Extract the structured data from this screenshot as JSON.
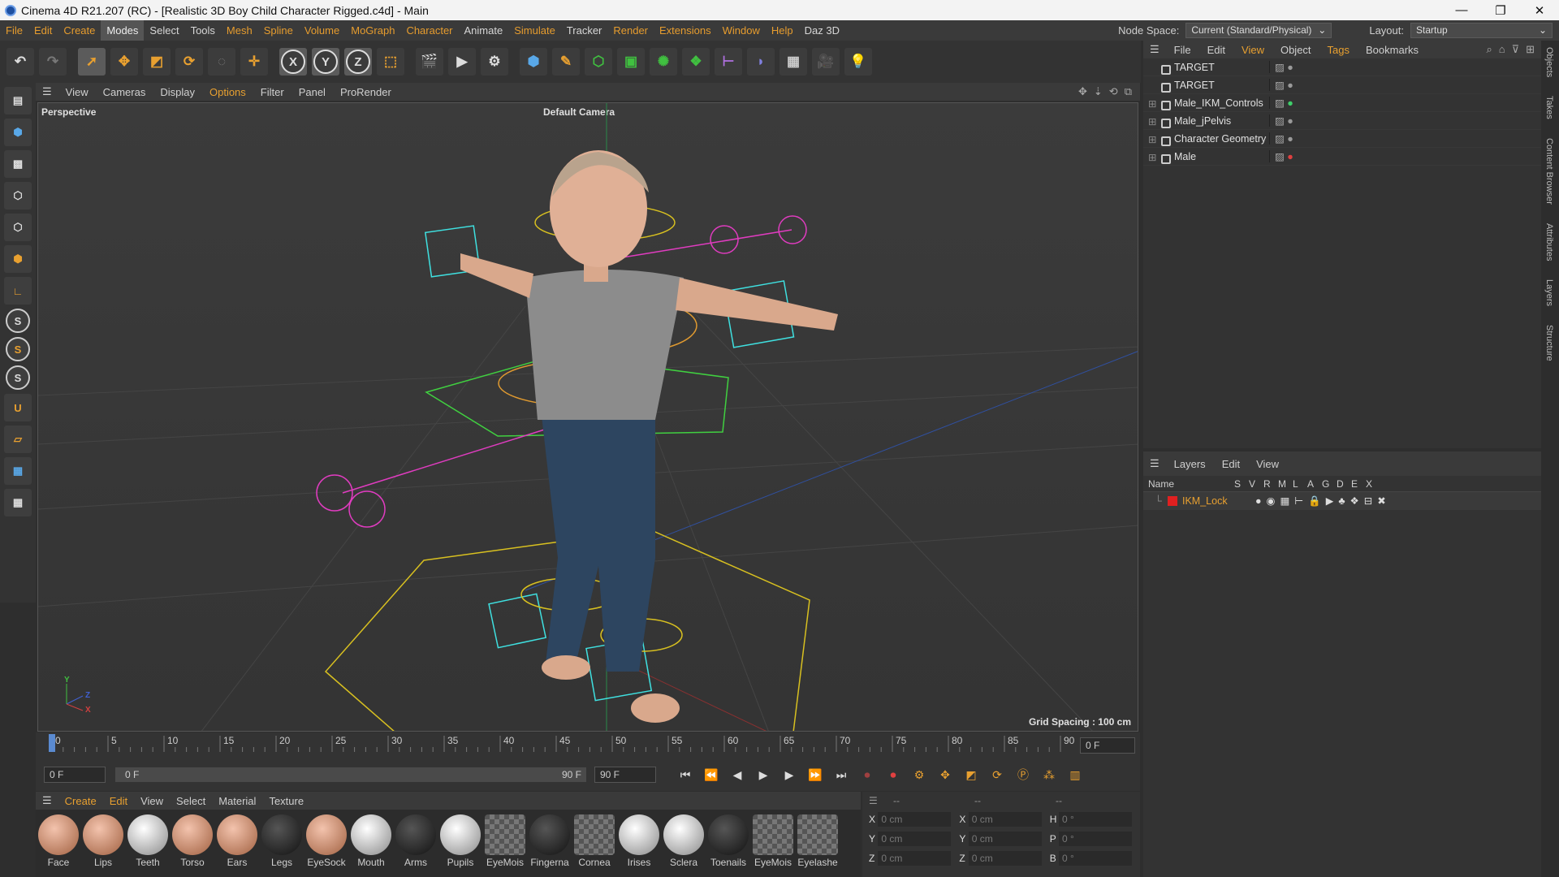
{
  "window": {
    "title": "Cinema 4D R21.207 (RC) - [Realistic 3D Boy Child Character Rigged.c4d] - Main",
    "controls": [
      "—",
      "❐",
      "✕"
    ]
  },
  "menu": {
    "items": [
      {
        "label": "File",
        "color": "orange"
      },
      {
        "label": "Edit",
        "color": "orange"
      },
      {
        "label": "Create",
        "color": "orange"
      },
      {
        "label": "Modes",
        "color": "active"
      },
      {
        "label": "Select",
        "color": "white"
      },
      {
        "label": "Tools",
        "color": "white"
      },
      {
        "label": "Mesh",
        "color": "orange"
      },
      {
        "label": "Spline",
        "color": "orange"
      },
      {
        "label": "Volume",
        "color": "orange"
      },
      {
        "label": "MoGraph",
        "color": "orange"
      },
      {
        "label": "Character",
        "color": "orange"
      },
      {
        "label": "Animate",
        "color": "white"
      },
      {
        "label": "Simulate",
        "color": "orange"
      },
      {
        "label": "Tracker",
        "color": "white"
      },
      {
        "label": "Render",
        "color": "orange"
      },
      {
        "label": "Extensions",
        "color": "orange"
      },
      {
        "label": "Window",
        "color": "orange"
      },
      {
        "label": "Help",
        "color": "orange"
      },
      {
        "label": "Daz 3D",
        "color": "white"
      }
    ],
    "node_space_label": "Node Space:",
    "node_space_value": "Current (Standard/Physical)",
    "layout_label": "Layout:",
    "layout_value": "Startup"
  },
  "toolbar": {
    "icons": [
      "undo-icon",
      "redo-icon",
      "select-arrow-icon",
      "move-icon",
      "scale-icon",
      "rotate-icon",
      "recent-tool-icon",
      "world-axis-icon",
      "x-axis-icon",
      "y-axis-icon",
      "z-axis-icon",
      "coordinate-system-icon",
      "render-view-icon",
      "render-picture-icon",
      "render-settings-icon",
      "cube-icon",
      "pen-icon",
      "subdivision-icon",
      "extrude-icon",
      "mograph-cloner-icon",
      "array-icon",
      "symmetry-icon",
      "deformer-icon",
      "floor-icon",
      "camera-icon",
      "light-icon"
    ],
    "axis_labels": [
      "X",
      "Y",
      "Z"
    ]
  },
  "viewport": {
    "menu": [
      {
        "label": "View",
        "color": "white"
      },
      {
        "label": "Cameras",
        "color": "white"
      },
      {
        "label": "Display",
        "color": "white"
      },
      {
        "label": "Options",
        "color": "orange"
      },
      {
        "label": "Filter",
        "color": "white"
      },
      {
        "label": "Panel",
        "color": "white"
      },
      {
        "label": "ProRender",
        "color": "white"
      }
    ],
    "view_name": "Perspective",
    "camera": "Default Camera",
    "grid_spacing": "Grid Spacing : 100 cm",
    "axis_labels": [
      "Y",
      "Z",
      "X"
    ]
  },
  "timeline": {
    "ticks": [
      "0",
      "5",
      "10",
      "15",
      "20",
      "25",
      "30",
      "35",
      "40",
      "45",
      "50",
      "55",
      "60",
      "65",
      "70",
      "75",
      "80",
      "85",
      "90"
    ],
    "current_frame": "0 F",
    "start_field": "0 F",
    "range_start": "0 F",
    "range_end": "90 F",
    "end_field": "90 F",
    "min_frame": 0,
    "max_frame": 90,
    "playhead_frame": 0
  },
  "materials": {
    "menu": [
      {
        "label": "Create",
        "color": "orange"
      },
      {
        "label": "Edit",
        "color": "orange"
      },
      {
        "label": "View",
        "color": "white"
      },
      {
        "label": "Select",
        "color": "white"
      },
      {
        "label": "Material",
        "color": "white"
      },
      {
        "label": "Texture",
        "color": "white"
      }
    ],
    "items": [
      {
        "name": "Face",
        "style": "skin"
      },
      {
        "name": "Lips",
        "style": "skin"
      },
      {
        "name": "Teeth",
        "style": "white"
      },
      {
        "name": "Torso",
        "style": "skin"
      },
      {
        "name": "Ears",
        "style": "skin"
      },
      {
        "name": "Legs",
        "style": "dark"
      },
      {
        "name": "EyeSock",
        "style": "skin"
      },
      {
        "name": "Mouth",
        "style": "white"
      },
      {
        "name": "Arms",
        "style": "dark"
      },
      {
        "name": "Pupils",
        "style": "white"
      },
      {
        "name": "EyeMois",
        "style": "check"
      },
      {
        "name": "Fingerna",
        "style": "dark"
      },
      {
        "name": "Cornea",
        "style": "check"
      },
      {
        "name": "Irises",
        "style": "white"
      },
      {
        "name": "Sclera",
        "style": "white"
      },
      {
        "name": "Toenails",
        "style": "dark"
      },
      {
        "name": "EyeMois",
        "style": "check"
      },
      {
        "name": "Eyelashe",
        "style": "check"
      }
    ]
  },
  "coords": {
    "header": [
      "--",
      "--",
      "--"
    ],
    "rows": [
      {
        "a": "X",
        "av": "0 cm",
        "b": "X",
        "bv": "0 cm",
        "c": "H",
        "cv": "0 °"
      },
      {
        "a": "Y",
        "av": "0 cm",
        "b": "Y",
        "bv": "0 cm",
        "c": "P",
        "cv": "0 °"
      },
      {
        "a": "Z",
        "av": "0 cm",
        "b": "Z",
        "bv": "0 cm",
        "c": "B",
        "cv": "0 °"
      }
    ]
  },
  "objects": {
    "menu": [
      {
        "label": "File",
        "color": "white"
      },
      {
        "label": "Edit",
        "color": "white"
      },
      {
        "label": "View",
        "color": "orange"
      },
      {
        "label": "Object",
        "color": "white"
      },
      {
        "label": "Tags",
        "color": "orange"
      },
      {
        "label": "Bookmarks",
        "color": "white"
      }
    ],
    "rows": [
      {
        "name": "TARGET",
        "expandable": false,
        "dot": "#9a9a9a"
      },
      {
        "name": "TARGET",
        "expandable": false,
        "dot": "#9a9a9a"
      },
      {
        "name": "Male_IKM_Controls",
        "expandable": true,
        "dot": "#3fcf6a"
      },
      {
        "name": "Male_jPelvis",
        "expandable": true,
        "dot": "#9a9a9a"
      },
      {
        "name": "Character Geometry",
        "expandable": true,
        "dot": "#9a9a9a"
      },
      {
        "name": "Male",
        "expandable": true,
        "dot": "#e04040"
      }
    ]
  },
  "layers": {
    "menu": [
      "Layers",
      "Edit",
      "View"
    ],
    "columns": [
      "Name",
      "S",
      "V",
      "R",
      "M",
      "L",
      "A",
      "G",
      "D",
      "E",
      "X"
    ],
    "rows": [
      {
        "name": "IKM_Lock",
        "color": "#e02020"
      }
    ]
  },
  "side_tabs": [
    "Objects",
    "Takes",
    "Content Browser",
    "Attributes",
    "Layers",
    "Structure"
  ],
  "colors": {
    "accent": "#e8a030",
    "rig_cyan": "#3fe0e0",
    "rig_magenta": "#e03cc0",
    "rig_yellow": "#d8c020",
    "rig_orange": "#e09a30",
    "rig_green": "#40d040"
  }
}
